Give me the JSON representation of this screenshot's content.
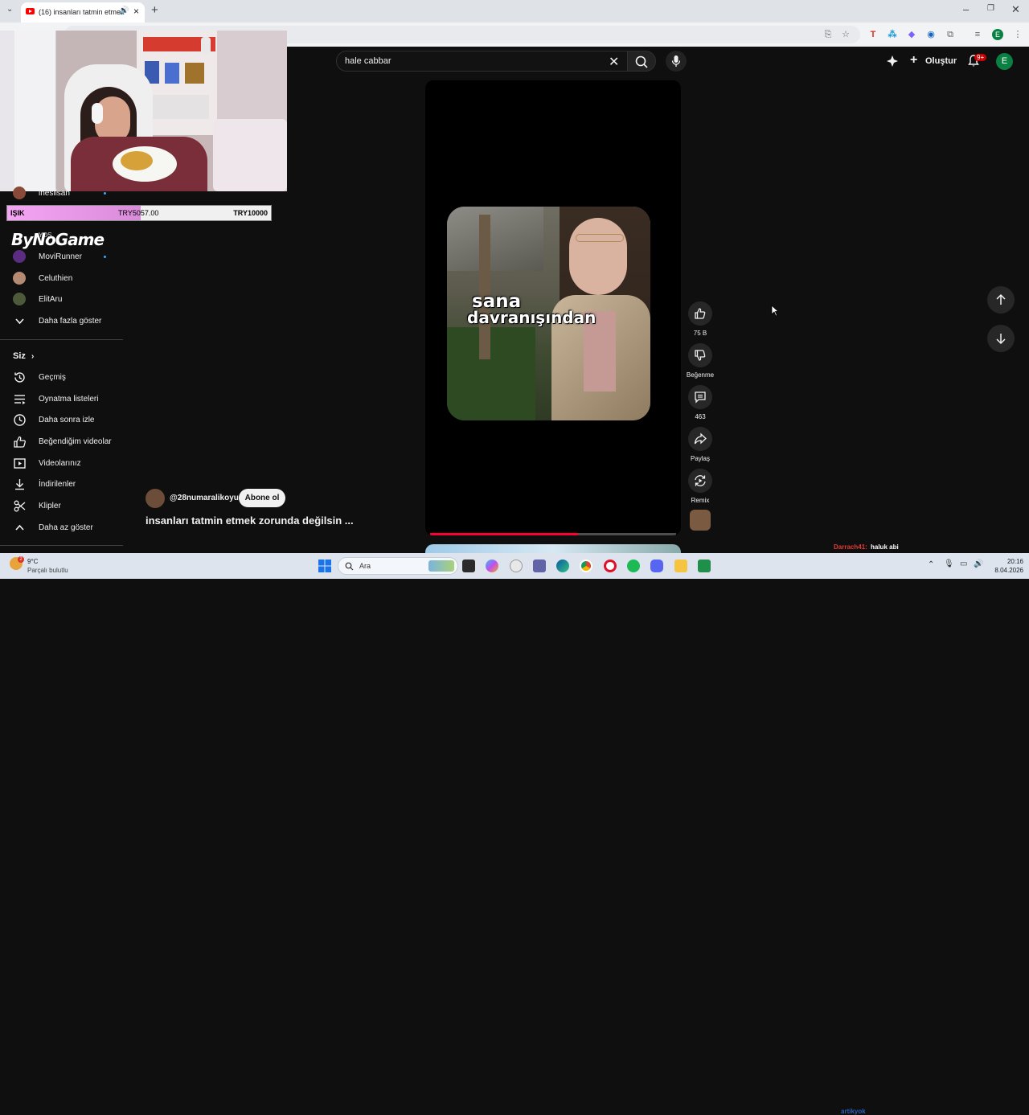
{
  "browser": {
    "tab_title": "(16) insanları tatmin etmek",
    "icons": [
      "chevron-down-icon",
      "audio-icon",
      "close-icon",
      "plus-icon",
      "minimize-icon",
      "restore-icon",
      "close-window-icon"
    ]
  },
  "header": {
    "search_value": "hale cabbar",
    "create_label": "Oluştur",
    "notifications_badge": "9+",
    "avatar_letter": "E"
  },
  "donation": {
    "name": "IŞIK",
    "current": "TRY5057.00",
    "goal": "TRY10000",
    "progress": 0.5057
  },
  "overlay": {
    "brand": "ByNoGame",
    "yds_label": "YDS"
  },
  "sidebar": {
    "subscriptions": [
      {
        "label": "inesilsan",
        "live_dot": true
      },
      {
        "label": "MoviRunner",
        "live_dot": true
      },
      {
        "label": "Celuthien",
        "live_dot": false
      },
      {
        "label": "ElitAru",
        "live_dot": false
      }
    ],
    "show_more": "Daha fazla göster",
    "you_label": "Siz",
    "you_items": [
      {
        "label": "Geçmiş",
        "icon": "history-icon"
      },
      {
        "label": "Oynatma listeleri",
        "icon": "playlists-icon"
      },
      {
        "label": "Daha sonra izle",
        "icon": "watch-later-icon"
      },
      {
        "label": "Beğendiğim videolar",
        "icon": "liked-icon"
      },
      {
        "label": "Videolarınız",
        "icon": "your-videos-icon"
      },
      {
        "label": "İndirilenler",
        "icon": "downloads-icon"
      },
      {
        "label": "Klipler",
        "icon": "clips-icon"
      }
    ],
    "show_less": "Daha az göster"
  },
  "short": {
    "caption_line1": "sana",
    "caption_line2": "davranışından",
    "channel": "@28numaralikoyun",
    "subscribe_label": "Abone ol",
    "title": "insanları tatmin etmek zorunda değilsin ...",
    "progress": 0.6
  },
  "actions": {
    "likes": "75 B",
    "dislike": "Beğenme",
    "comments": "463",
    "share": "Paylaş",
    "remix": "Remix"
  },
  "chat": {
    "user": "Darrach41:",
    "message": "haluk abi",
    "user2": "artikyok",
    "message2": "..."
  },
  "taskbar": {
    "weather_badge": "2",
    "temperature": "9°C",
    "condition": "Parçalı bulutlu",
    "search_placeholder": "Ara",
    "time": "20:16",
    "date": "8.04.2026"
  }
}
